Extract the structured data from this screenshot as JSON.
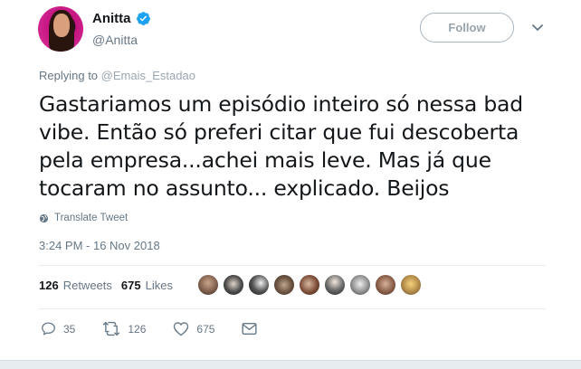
{
  "user": {
    "name": "Anitta",
    "handle": "@Anitta",
    "follow_label": "Follow"
  },
  "reply": {
    "prefix": "Replying to",
    "to": "@Emais_Estadao"
  },
  "tweet": {
    "text": "Gastariamos um episódio inteiro só nessa bad vibe. Então só preferi citar que fui descoberta pela empresa...achei mais leve. Mas já que tocaram no assunto... explicado. Beijos",
    "translate_label": "Translate Tweet",
    "timestamp": "3:24 PM - 16 Nov 2018"
  },
  "stats": {
    "retweets_count": "126",
    "retweets_label": "Retweets",
    "likes_count": "675",
    "likes_label": "Likes"
  },
  "actions": {
    "replies": "35",
    "retweets": "126",
    "likes": "675"
  },
  "colors": {
    "verified": "#1da1f2",
    "muted": "#657786",
    "text": "#14171a"
  }
}
